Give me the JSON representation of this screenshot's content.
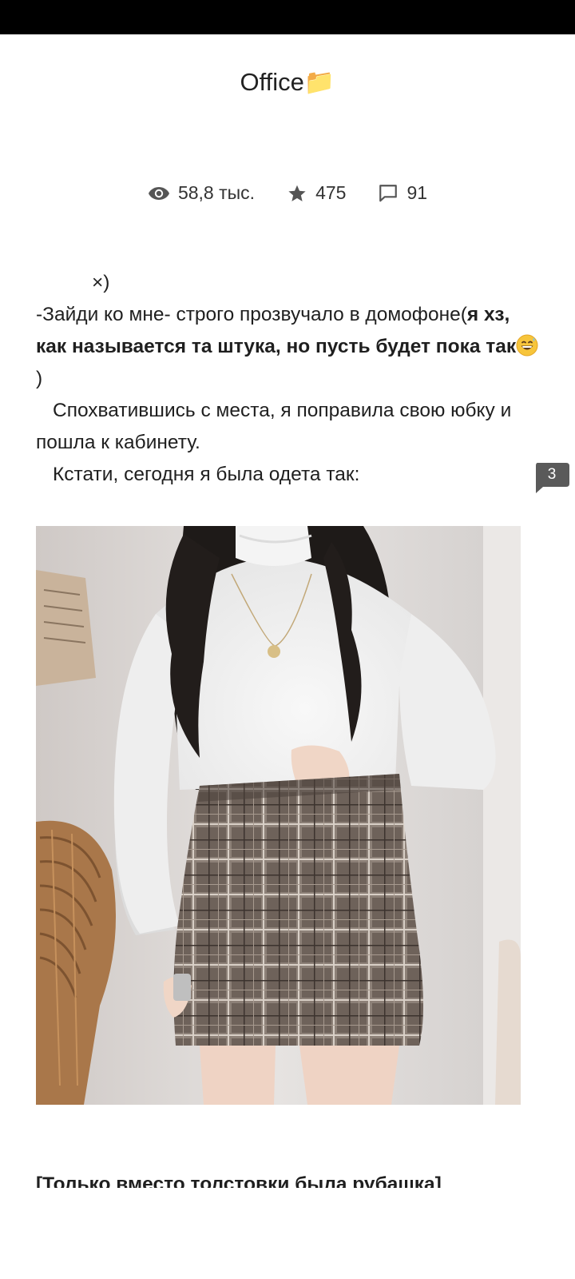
{
  "chapter": {
    "title": "Office📁"
  },
  "stats": {
    "views": "58,8 тыс.",
    "stars": "475",
    "comments": "91"
  },
  "story": {
    "line1": "×)",
    "p2_normal": "-Зайди ко мне- строго прозвучало в домофоне(",
    "p2_bold": "я хз, как называется та штука, но пусть будет пока так",
    "p2_close": ")",
    "p3": "Спохватившись с места, я поправила свою юбку и пошла к кабинету.",
    "p4": "Кстати, сегодня я была одета так:"
  },
  "paragraph_comment": {
    "count": "3"
  },
  "photo": {
    "alt": "outfit photo: white sweater and plaid mini skirt"
  },
  "caption": {
    "text": "[Только вместо толстовки была рубашка]"
  },
  "icons": {
    "views": "eye-icon",
    "stars": "star-icon",
    "comments": "speech-bubble-icon",
    "folder": "folder-emoji",
    "laugh": "grinning-sweat-emoji"
  },
  "colors": {
    "text": "#1f1f1f",
    "icon": "#555555",
    "comment_marker": "#5a5a5a",
    "status_bar": "#000000"
  }
}
